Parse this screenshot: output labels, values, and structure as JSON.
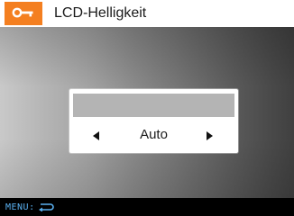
{
  "header": {
    "title": "LCD-Helligkeit",
    "icon": "wrench-icon",
    "accent_color": "#f47f20"
  },
  "dialog": {
    "value": "Auto",
    "prev_icon": "left-triangle-icon",
    "next_icon": "right-triangle-icon"
  },
  "footer": {
    "menu_label": "MENU:",
    "back_icon": "return-arrow-icon",
    "label_color": "#5ab0f0"
  }
}
